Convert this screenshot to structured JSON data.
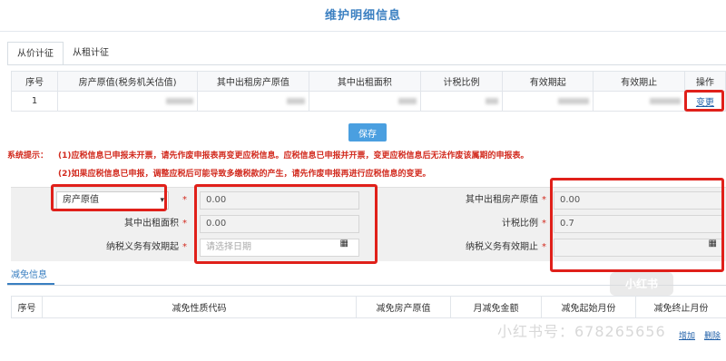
{
  "page": {
    "title": "维护明细信息"
  },
  "tabs": [
    {
      "label": "从价计征",
      "active": true
    },
    {
      "label": "从租计征",
      "active": false
    }
  ],
  "main_table": {
    "headers": [
      "序号",
      "房产原值(税务机关估值)",
      "其中出租房产原值",
      "其中出租面积",
      "计税比例",
      "有效期起",
      "有效期止",
      "操作"
    ],
    "rows": [
      {
        "index": "1",
        "action": "变更"
      }
    ]
  },
  "save_button": "保存",
  "notice": {
    "label": "系统提示：",
    "line1": "(1)应税信息已申报未开票，请先作废申报表再变更应税信息。应税信息已申报并开票，变更应税信息后无法作废该属期的申报表。",
    "line2": "(2)如果应税信息已申报，调整应税后可能导致多缴税款的产生，请先作废申报再进行应税信息的变更。"
  },
  "form": {
    "select_value": "房产原值",
    "original_value": "0.00",
    "rent_original_label": "其中出租房产原值",
    "rent_original_value": "0.00",
    "rent_area_label": "其中出租面积",
    "rent_area_value": "0.00",
    "tax_ratio_label": "计税比例",
    "tax_ratio_value": "0.7",
    "start_label": "纳税义务有效期起",
    "start_placeholder": "请选择日期",
    "end_label": "纳税义务有效期止",
    "required_mark": "*"
  },
  "relief": {
    "tab_label": "减免信息",
    "headers": [
      "序号",
      "减免性质代码",
      "减免房产原值",
      "月减免金额",
      "减免起始月份",
      "减免终止月份"
    ]
  },
  "bottom_links": [
    "增加",
    "删除"
  ],
  "watermark": "小红书号：678265656",
  "watermark_badge": "小红书",
  "colors": {
    "title": "#3a7fc1",
    "notice": "#d22a1e",
    "highlight_box": "#e0201a",
    "save_button": "#4a9fe0"
  }
}
